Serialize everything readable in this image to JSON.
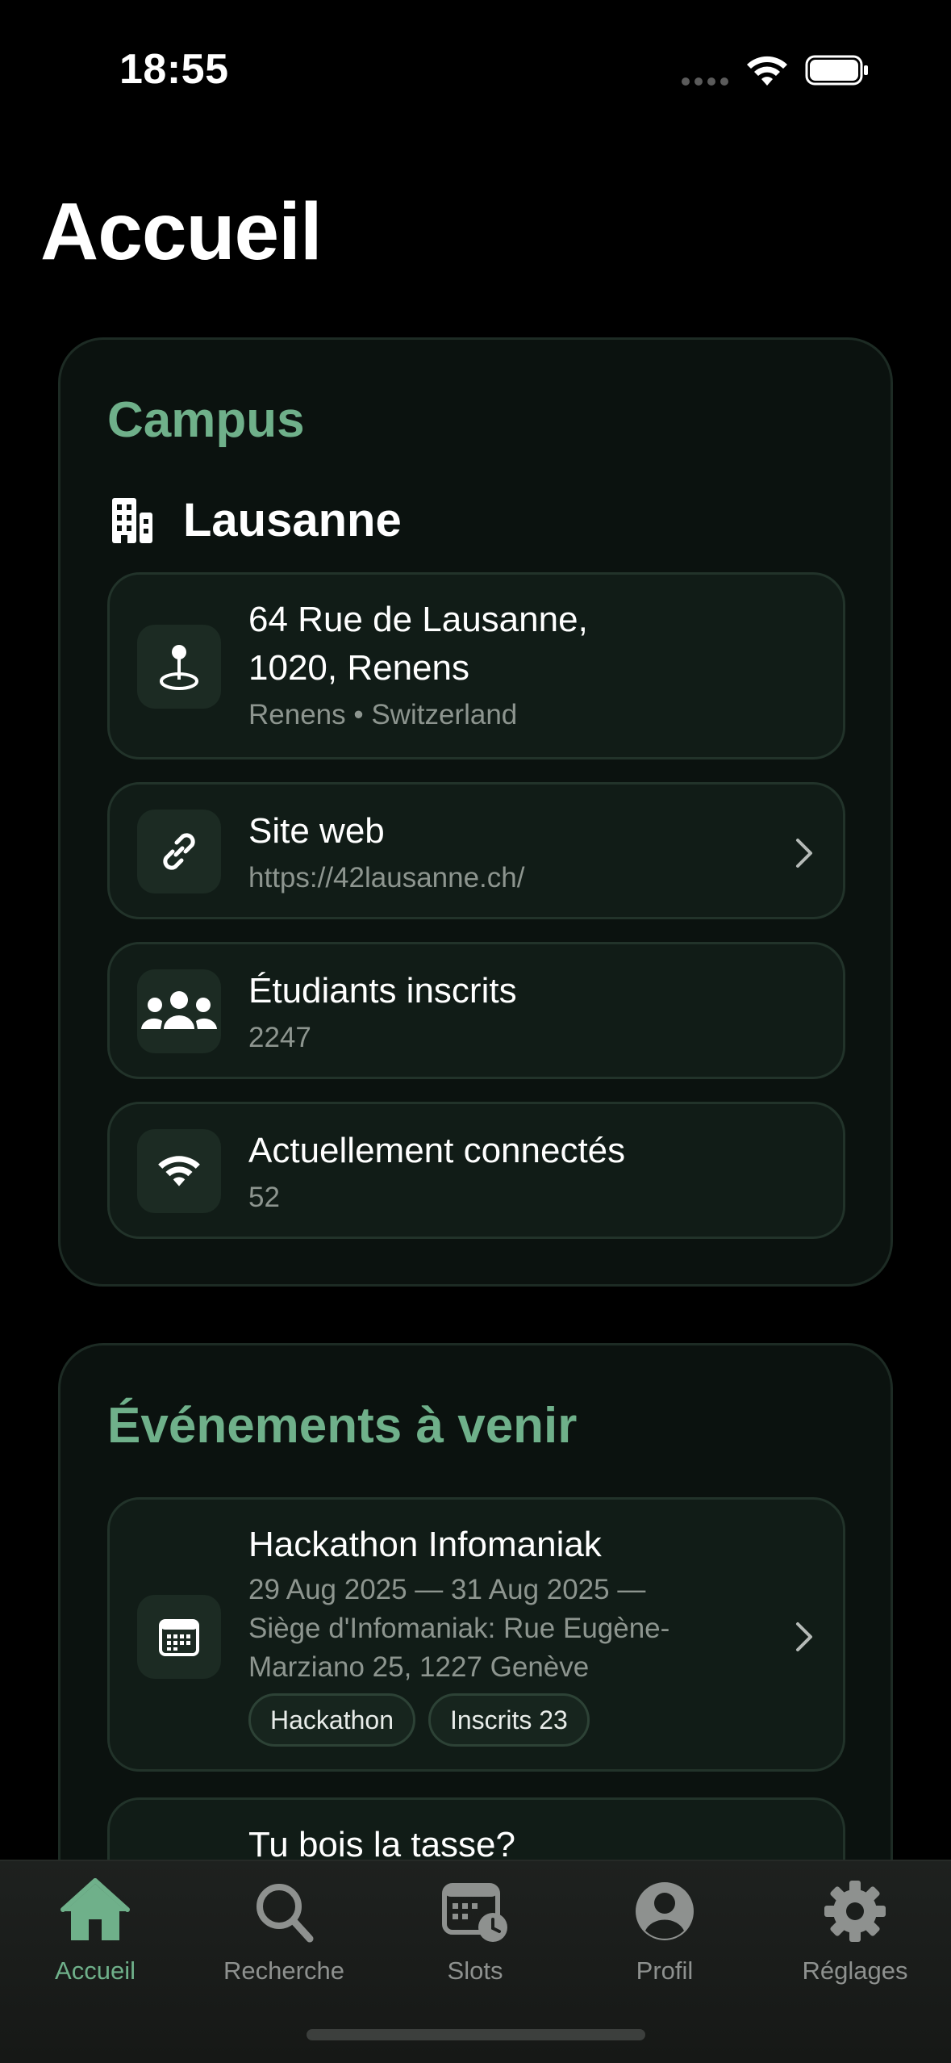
{
  "status": {
    "time": "18:55"
  },
  "page": {
    "title": "Accueil"
  },
  "campus": {
    "heading": "Campus",
    "name": "Lausanne",
    "address": {
      "line1": "64 Rue de Lausanne,",
      "line2": "1020, Renens",
      "sub": "Renens • Switzerland",
      "icon": "map-pin-icon"
    },
    "website": {
      "label": "Site web",
      "url": "https://42lausanne.ch/",
      "icon": "link-icon"
    },
    "students": {
      "label": "Étudiants inscrits",
      "value": "2247",
      "icon": "people-icon"
    },
    "connected": {
      "label": "Actuellement connectés",
      "value": "52",
      "icon": "wifi-icon"
    }
  },
  "events": {
    "heading": "Événements à venir",
    "items": [
      {
        "title": "Hackathon Infomaniak",
        "line1": "29 Aug 2025 — 31 Aug 2025 —",
        "line2": "Siège d'Infomaniak: Rue Eugène-",
        "line3": "Marziano 25, 1227 Genève",
        "tags": [
          "Hackathon",
          "Inscrits 23"
        ],
        "icon": "calendar-icon"
      },
      {
        "title": "Tu bois la tasse?"
      }
    ]
  },
  "tabbar": {
    "tabs": [
      {
        "label": "Accueil",
        "icon": "house-icon",
        "active": true
      },
      {
        "label": "Recherche",
        "icon": "magnifier-icon"
      },
      {
        "label": "Slots",
        "icon": "calendar-clock-icon"
      },
      {
        "label": "Profil",
        "icon": "person-circle-icon"
      },
      {
        "label": "Réglages",
        "icon": "gear-icon"
      }
    ]
  },
  "colors": {
    "accent": "#6fb08a",
    "background": "#000000",
    "card": "#0b120f",
    "row": "#111c17",
    "muted": "#8d958f"
  }
}
